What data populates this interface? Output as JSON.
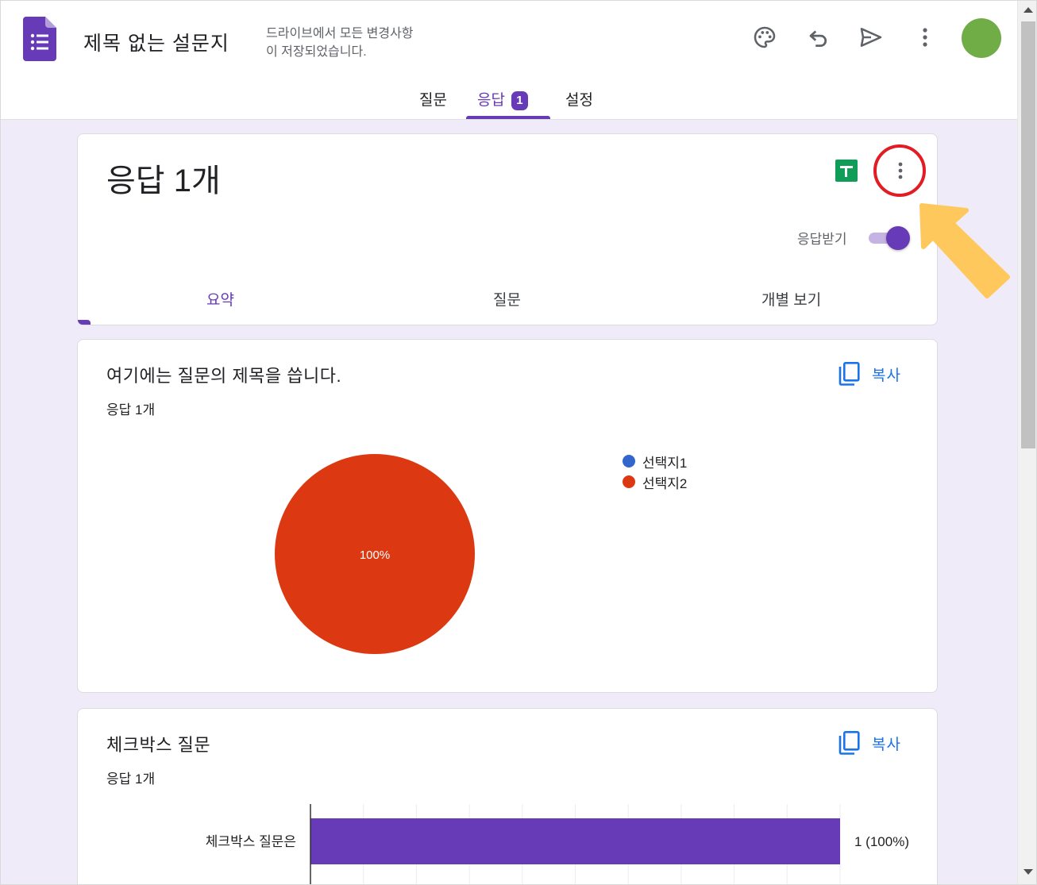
{
  "header": {
    "title": "제목 없는 설문지",
    "save_status_line1": "드라이브에서 모든 변경사항",
    "save_status_line2": "이 저장되었습니다."
  },
  "tabs": [
    {
      "label": "질문"
    },
    {
      "label": "응답",
      "badge": "1",
      "active": true
    },
    {
      "label": "설정"
    }
  ],
  "summary_card": {
    "title": "응답 1개",
    "accept_label": "응답받기",
    "accepting": true,
    "sub_tabs": [
      {
        "label": "요약",
        "active": true
      },
      {
        "label": "질문"
      },
      {
        "label": "개별 보기"
      }
    ]
  },
  "question_cards": [
    {
      "title": "여기에는 질문의 제목을 씁니다.",
      "count": "응답 1개",
      "copy_label": "복사"
    },
    {
      "title": "체크박스 질문",
      "count": "응답 1개",
      "copy_label": "복사"
    }
  ],
  "chart_data": [
    {
      "type": "pie",
      "categories": [
        "선택지1",
        "선택지2"
      ],
      "values": [
        0,
        100
      ],
      "colors": [
        "#3366cc",
        "#dc3912"
      ],
      "slice_label": "100%",
      "legend": "right"
    },
    {
      "type": "bar",
      "orientation": "horizontal",
      "categories": [
        "체크박스 질문은"
      ],
      "values": [
        1
      ],
      "value_labels": [
        "1 (100%)"
      ],
      "xlim": [
        0,
        1
      ],
      "color": "#673ab7",
      "grid": true
    }
  ],
  "colors": {
    "accent": "#673ab7",
    "background": "#f0ebf8",
    "link": "#1a73e8",
    "avatar": "#71ad47",
    "annotation_circle": "#e31b23",
    "annotation_arrow": "#ffc85c"
  }
}
